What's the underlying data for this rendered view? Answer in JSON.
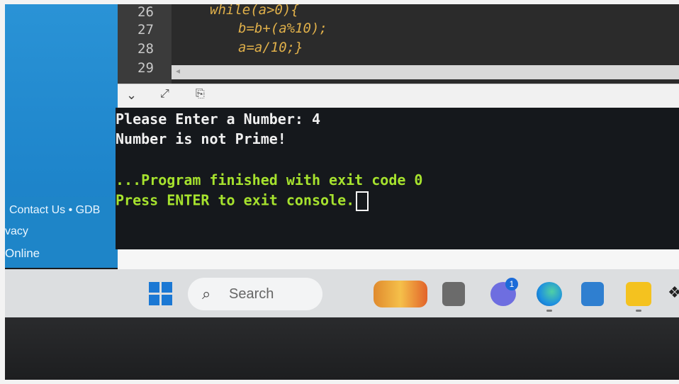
{
  "editor": {
    "lines": [
      {
        "number": "26",
        "code": "while(a>0){"
      },
      {
        "number": "27",
        "code": "b=b+(a%10);"
      },
      {
        "number": "28",
        "code": "a=a/10;}"
      },
      {
        "number": "29",
        "code": ""
      }
    ]
  },
  "sidebar": {
    "links": [
      "Contact Us • GDB",
      "vacy",
      "Online"
    ]
  },
  "console": {
    "lines": [
      "Please Enter a Number: 4",
      "Number is not Prime!",
      "",
      "...Program finished with exit code 0",
      "Press ENTER to exit console."
    ]
  },
  "taskbar": {
    "search_placeholder": "Search",
    "chat_badge": "1"
  },
  "colors": {
    "console_bg": "#15181c",
    "console_green": "#a6e22e",
    "sidebar_blue": "#1f86cc",
    "code_orange": "#e0b04a"
  }
}
